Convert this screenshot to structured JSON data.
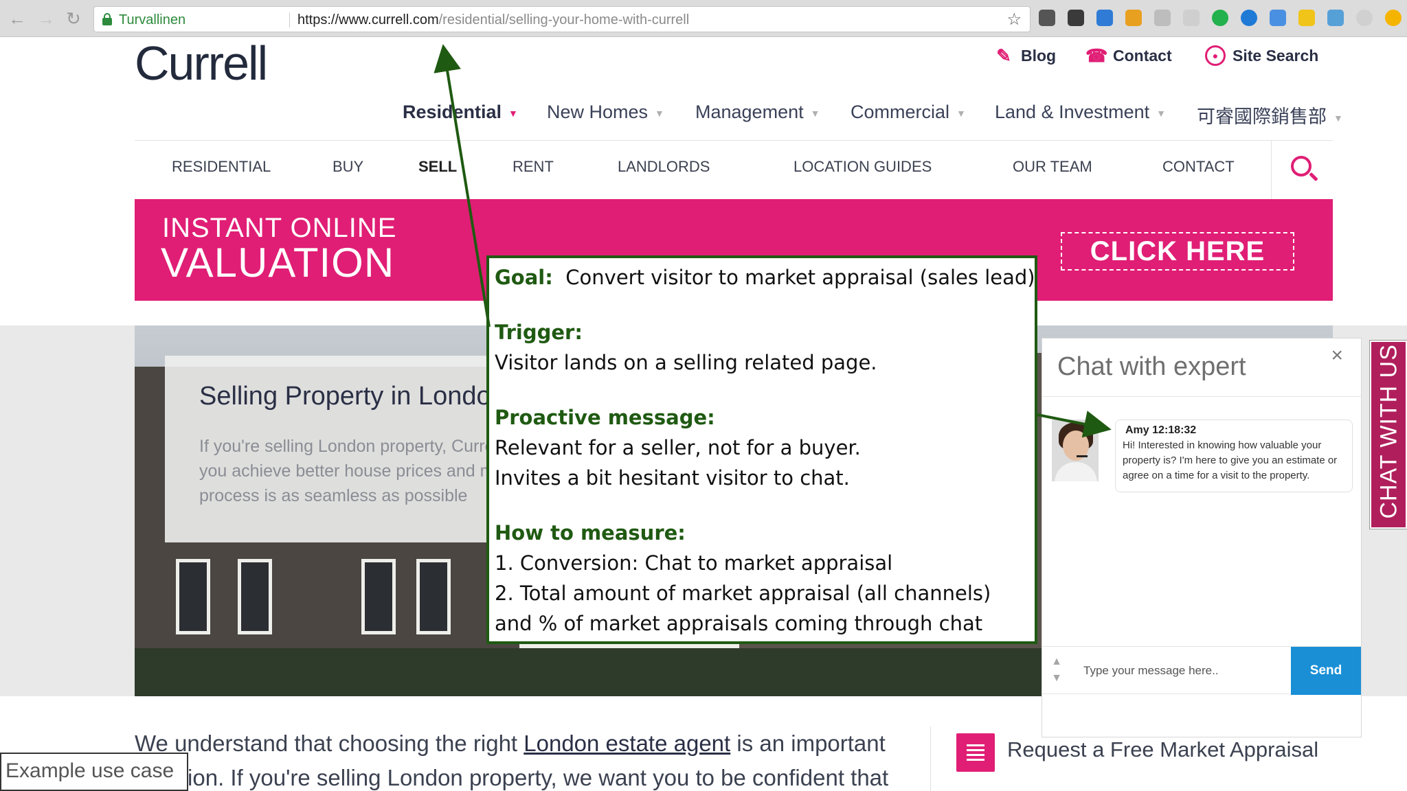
{
  "browser": {
    "secure_label": "Turvallinen",
    "url_host": "https://www.currell.com",
    "url_path": "/residential/selling-your-home-with-currell"
  },
  "site": {
    "logo": "Currell",
    "utility": {
      "blog": "Blog",
      "contact": "Contact",
      "search": "Site Search"
    },
    "main_nav": [
      "Residential",
      "New Homes",
      "Management",
      "Commercial",
      "Land & Investment",
      "可睿國際銷售部"
    ],
    "sub_nav": [
      "RESIDENTIAL",
      "BUY",
      "SELL",
      "RENT",
      "LANDLORDS",
      "LOCATION GUIDES",
      "OUR TEAM",
      "CONTACT"
    ],
    "banner": {
      "line1": "INSTANT ONLINE",
      "line2": "VALUATION",
      "cta": "CLICK HERE"
    },
    "hero": {
      "heading": "Selling Property in London",
      "text": "If you're selling London property, Currell will help you achieve better house prices and make the process is as seamless as possible"
    },
    "body": {
      "before_link": "We understand that choosing the right ",
      "link": "London estate agent",
      "after_link": " is an important decision. If you're selling London property, we want you to be confident that"
    },
    "request": "Request a Free Market Appraisal",
    "accent": "#e01e75"
  },
  "chat": {
    "title": "Chat with expert",
    "close": "×",
    "agent_name": "Amy",
    "time": "12:18:32",
    "message": "Hi! Interested in knowing how valuable your property is? I'm here to give you an estimate or agree on a time for a visit to the property.",
    "input_placeholder": "Type your message here..",
    "send": "Send",
    "tab": "CHAT WITH US",
    "send_color": "#1a8fd6"
  },
  "annotation": {
    "goal_label": "Goal:",
    "goal_text": "Convert visitor to market appraisal (sales lead)",
    "trigger_label": "Trigger:",
    "trigger_text": "Visitor lands on a selling related page.",
    "proactive_label": "Proactive message:",
    "proactive_lines": [
      "Relevant for a seller, not for a buyer.",
      "Invites a bit hesitant visitor to chat."
    ],
    "measure_label": "How to measure:",
    "measure_lines": [
      "1. Conversion: Chat to market appraisal",
      "2. Total amount of market appraisal (all channels)",
      "and % of market appraisals coming through chat"
    ],
    "border_color": "#1f5a12"
  },
  "caption": "Example use case"
}
